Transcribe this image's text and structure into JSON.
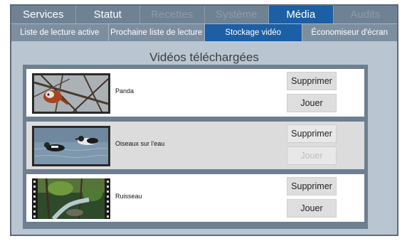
{
  "tabs": [
    {
      "label": "Services",
      "state": "normal"
    },
    {
      "label": "Statut",
      "state": "normal"
    },
    {
      "label": "Recettes",
      "state": "disabled"
    },
    {
      "label": "Système",
      "state": "disabled"
    },
    {
      "label": "Média",
      "state": "active"
    },
    {
      "label": "Audits",
      "state": "disabled"
    }
  ],
  "subtabs": [
    {
      "label": "Liste de lecture active",
      "state": "normal"
    },
    {
      "label": "Prochaine liste de lecture",
      "state": "normal"
    },
    {
      "label": "Stockage vidéo",
      "state": "active"
    },
    {
      "label": "Économiseur d'écran",
      "state": "normal"
    }
  ],
  "page_title": "Vidéos téléchargées",
  "videos": [
    {
      "title": "Panda",
      "delete_label": "Supprimer",
      "play_label": "Jouer",
      "play_enabled": true,
      "selected": false,
      "thumbnail": "red-panda-in-branches"
    },
    {
      "title": "Oiseaux sur l'eau",
      "delete_label": "Supprimer",
      "play_label": "Jouer",
      "play_enabled": false,
      "selected": true,
      "thumbnail": "ducks-on-water"
    },
    {
      "title": "Ruisseau",
      "delete_label": "Supprimer",
      "play_label": "Jouer",
      "play_enabled": true,
      "selected": false,
      "thumbnail": "forest-stream"
    }
  ],
  "colors": {
    "accent": "#1d5fa5",
    "tab_bar": "#6e8294",
    "panel_bg": "#b9c6d2",
    "list_bg": "#6d7f91"
  }
}
